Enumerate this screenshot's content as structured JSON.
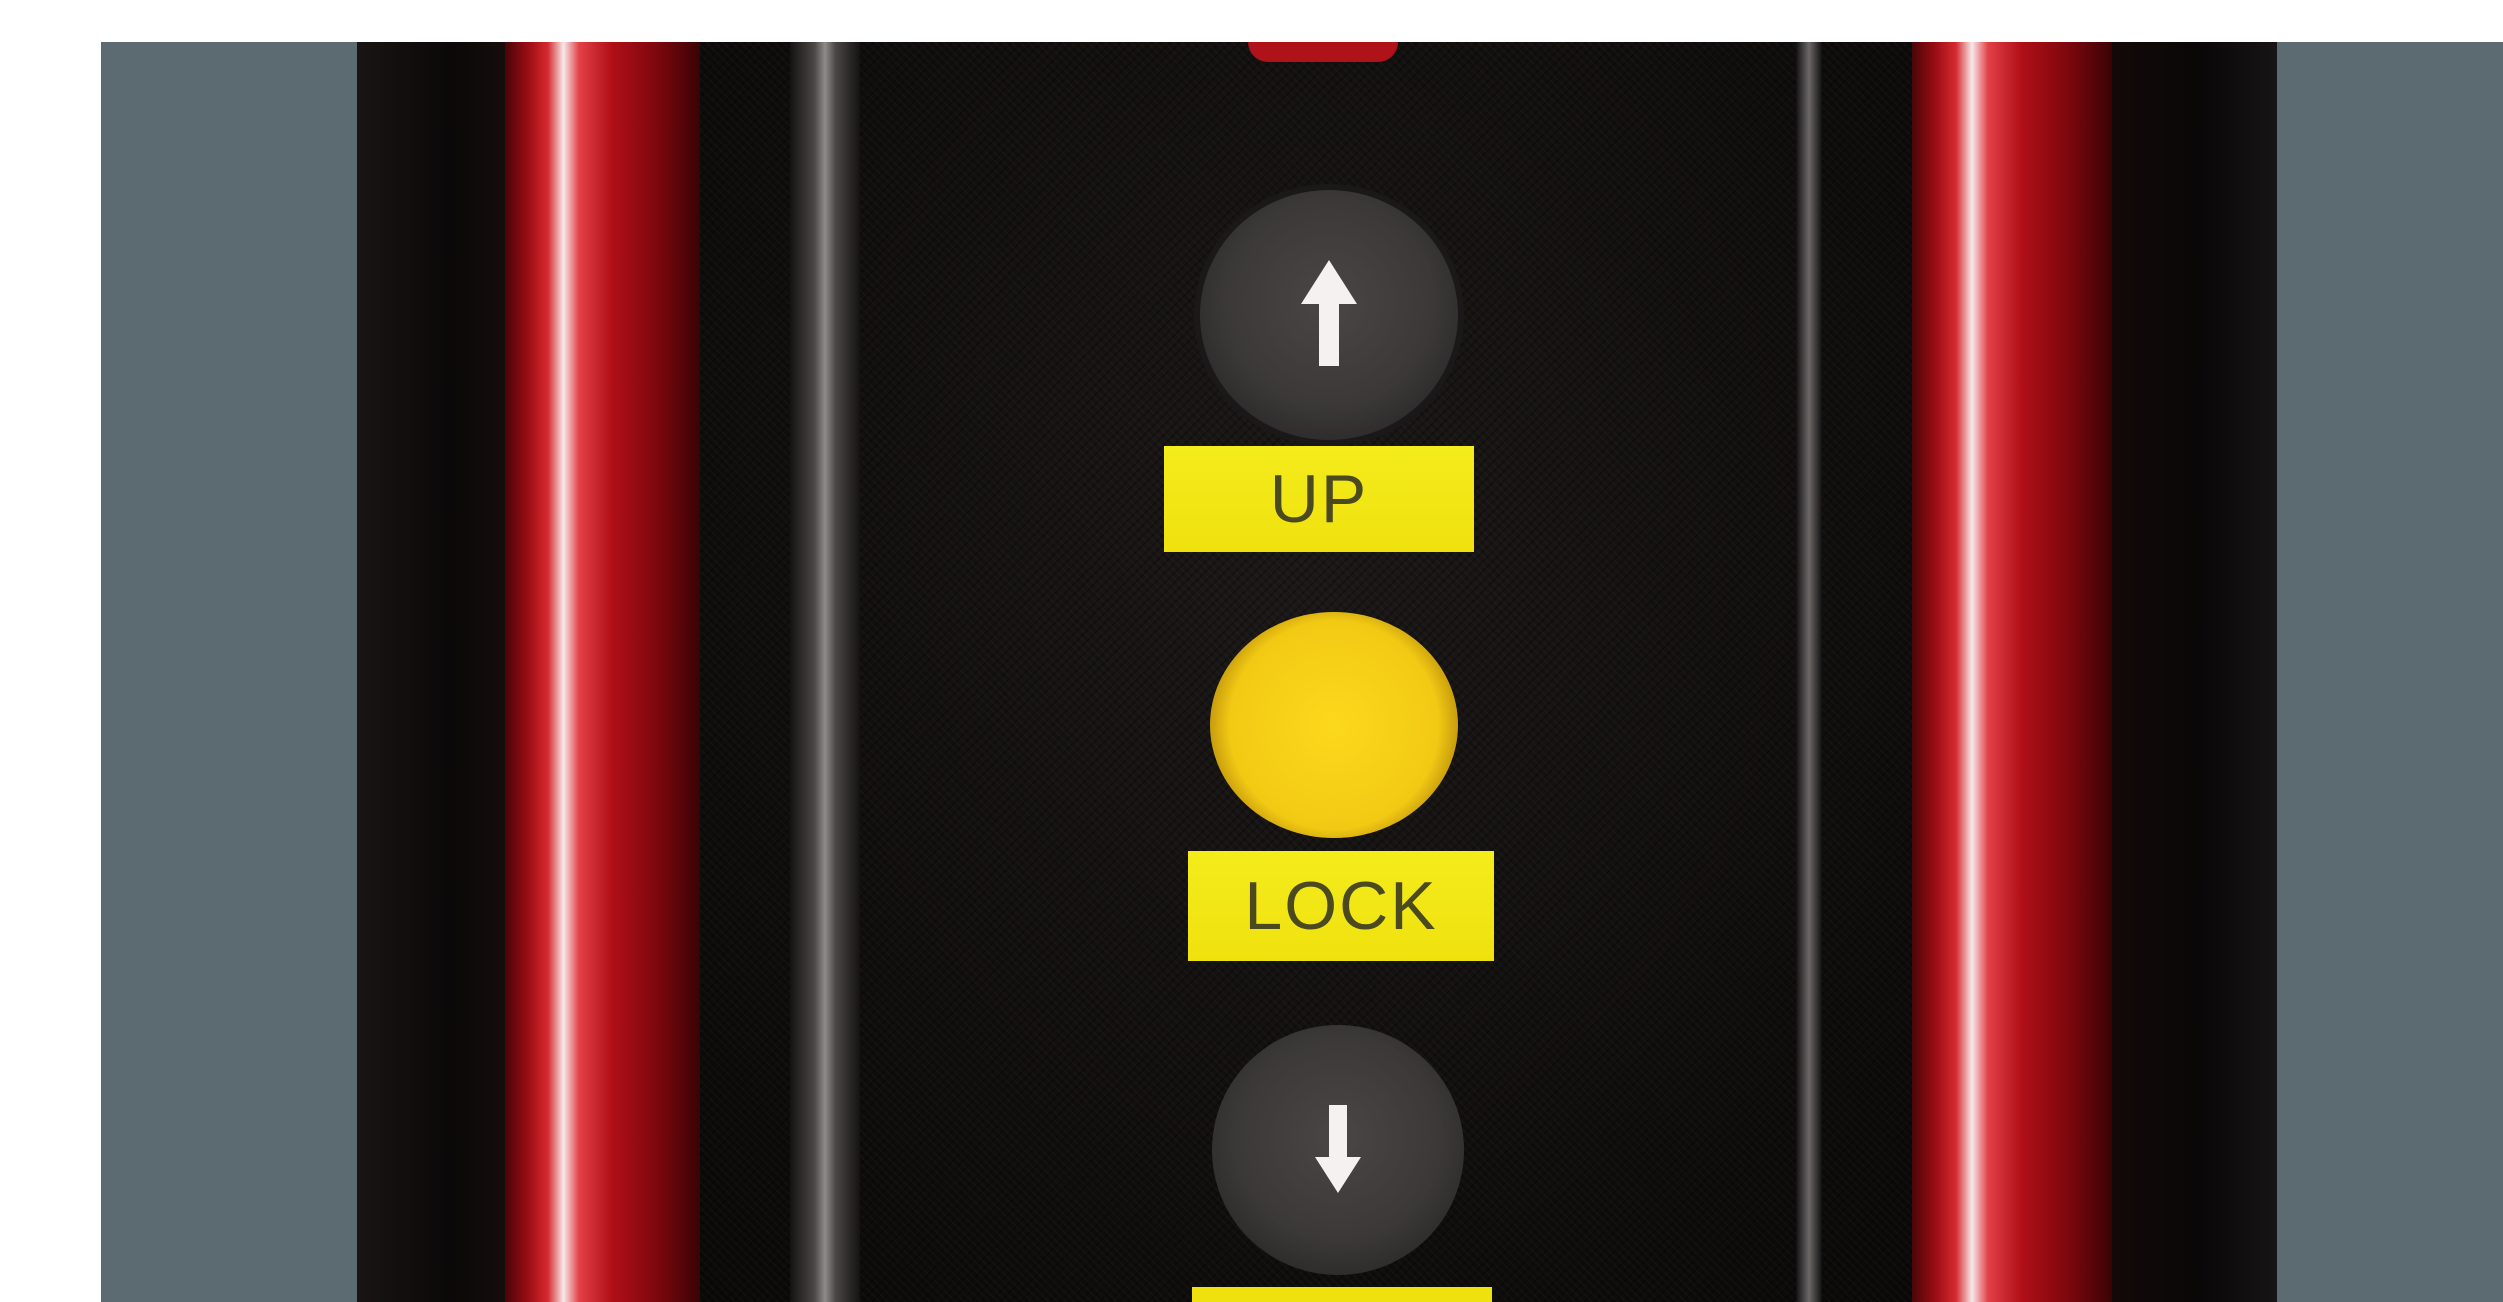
{
  "panel": {
    "buttons": [
      {
        "id": "up",
        "label": "UP",
        "color": "#3f3c3c",
        "arrow": "arrow-up-icon"
      },
      {
        "id": "lock",
        "label": "LOCK",
        "color": "#f4cd14"
      },
      {
        "id": "down",
        "label": "",
        "color": "#3f3c3c",
        "arrow": "arrow-down-icon"
      }
    ],
    "colors": {
      "rail": "#c01820",
      "side": "#5c6b71",
      "label": "#f2e412"
    }
  }
}
